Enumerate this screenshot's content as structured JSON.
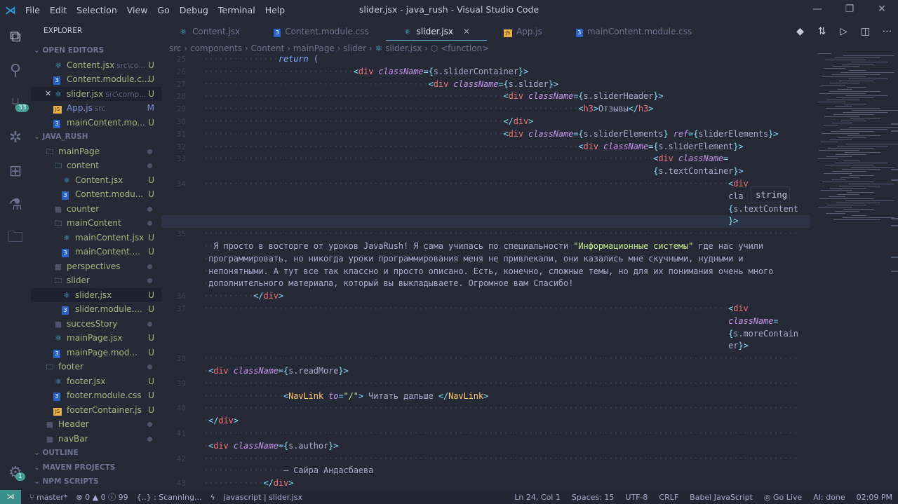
{
  "window": {
    "title": "slider.jsx - java_rush - Visual Studio Code",
    "menu": [
      "File",
      "Edit",
      "Selection",
      "View",
      "Go",
      "Debug",
      "Terminal",
      "Help"
    ]
  },
  "activity": {
    "icons": [
      "files-icon",
      "search-icon",
      "source-control-icon",
      "debug-icon",
      "extensions-icon",
      "test-flask-icon",
      "folder-icon"
    ],
    "scm_badge": "33",
    "settings_badge": "1"
  },
  "sidebar": {
    "title": "EXPLORER",
    "rows": [
      {
        "kind": "section",
        "label": "OPEN EDITORS"
      },
      {
        "icon": "react",
        "label": "Content.jsx",
        "sub": "src\\co...",
        "status": "U",
        "level": 2
      },
      {
        "icon": "css",
        "label": "Content.module.c...",
        "status": "U",
        "level": 2
      },
      {
        "icon": "react",
        "label": "slider.jsx",
        "sub": "src\\comp...",
        "status": "U",
        "level": 2,
        "close": true,
        "selected": true
      },
      {
        "icon": "js",
        "label": "App.js",
        "sub": "src",
        "status": "M",
        "level": 2
      },
      {
        "icon": "css",
        "label": "mainContent.mo...",
        "status": "U",
        "level": 2
      },
      {
        "kind": "section",
        "label": "JAVA_RUSH"
      },
      {
        "icon": "folder",
        "label": "mainPage",
        "level": 1,
        "dot": true
      },
      {
        "icon": "folder",
        "label": "content",
        "level": 2,
        "dot": true
      },
      {
        "icon": "react",
        "label": "Content.jsx",
        "status": "U",
        "level": 3
      },
      {
        "icon": "css",
        "label": "Content.modu...",
        "status": "U",
        "level": 3
      },
      {
        "icon": "folder-closed",
        "label": "counter",
        "level": 2,
        "dot": true
      },
      {
        "icon": "folder",
        "label": "mainContent",
        "level": 2,
        "dot": true
      },
      {
        "icon": "react",
        "label": "mainContent.jsx",
        "status": "U",
        "level": 3
      },
      {
        "icon": "css",
        "label": "mainContent....",
        "status": "U",
        "level": 3
      },
      {
        "icon": "folder-closed",
        "label": "perspectives",
        "level": 2,
        "dot": true
      },
      {
        "icon": "folder",
        "label": "slider",
        "level": 2,
        "dot": true
      },
      {
        "icon": "react",
        "label": "slider.jsx",
        "status": "U",
        "level": 3,
        "selected": true
      },
      {
        "icon": "css",
        "label": "slider.module....",
        "status": "U",
        "level": 3
      },
      {
        "icon": "folder-closed",
        "label": "succesStory",
        "level": 2,
        "dot": true
      },
      {
        "icon": "react",
        "label": "mainPage.jsx",
        "status": "U",
        "level": 2
      },
      {
        "icon": "css",
        "label": "mainPage.mod...",
        "status": "U",
        "level": 2
      },
      {
        "icon": "folder",
        "label": "footer",
        "level": 1,
        "dot": true
      },
      {
        "icon": "react",
        "label": "footer.jsx",
        "status": "U",
        "level": 2
      },
      {
        "icon": "css",
        "label": "footer.module.css",
        "status": "U",
        "level": 2
      },
      {
        "icon": "js",
        "label": "footerContainer.js",
        "status": "U",
        "level": 2
      },
      {
        "icon": "folder-closed",
        "label": "Header",
        "level": 1,
        "dot": true
      },
      {
        "icon": "folder-closed",
        "label": "navBar",
        "level": 1,
        "dot": true
      },
      {
        "kind": "section",
        "label": "OUTLINE"
      },
      {
        "kind": "section",
        "label": "MAVEN PROJECTS"
      },
      {
        "kind": "section",
        "label": "NPM SCRIPTS"
      }
    ]
  },
  "tabs": [
    {
      "icon": "react",
      "label": "Content.jsx"
    },
    {
      "icon": "css",
      "label": "Content.module.css"
    },
    {
      "icon": "react",
      "label": "slider.jsx",
      "active": true
    },
    {
      "icon": "js",
      "label": "App.js"
    },
    {
      "icon": "css",
      "label": "mainContent.module.css"
    }
  ],
  "breadcrumb": [
    "src",
    "components",
    "Content",
    "mainPage",
    "slider",
    "slider.jsx",
    "<function>"
  ],
  "editor": {
    "rows": [
      {
        "n": "25",
        "t": "               return ("
      },
      {
        "n": "26",
        "t": "                              <div className={s.sliderContainer}>"
      },
      {
        "n": "27",
        "t": "                                             <div className={s.slider}>"
      },
      {
        "n": "28",
        "t": "                                                            <div className={s.sliderHeader}>"
      },
      {
        "n": "29",
        "t": "                                                                           <h3>Отзывы</h3>"
      },
      {
        "n": "30",
        "t": "                                                            </div>"
      },
      {
        "n": "31",
        "t": "                                                            <div className={s.sliderElements} ref={sliderElements}>"
      },
      {
        "n": "32",
        "t": "                                                                           <div className={s.sliderElement}>"
      },
      {
        "n": "33",
        "t": "                                                                                          <div className="
      },
      {
        "n": "",
        "t": "                                                                                          {s.textContainer}>"
      },
      {
        "n": "34",
        "t": "                                                                                                         <div"
      },
      {
        "n": "",
        "t": "                                                                                                         cla"
      },
      {
        "n": "",
        "t": "                                                                                                         {s.textContent"
      },
      {
        "n": "",
        "t": "                                                                                                         }>",
        "cur": true
      },
      {
        "n": "35",
        "t": "                                                                                                                       "
      },
      {
        "n": "",
        "t": "  Я просто в восторге от уроков JavaRush! Я сама училась по специальности \"Информационные системы\" где нас учили"
      },
      {
        "n": "",
        "t": " программировать, но никогда уроки программирования меня не привлекали, они казались мне скучными, нудными и"
      },
      {
        "n": "",
        "t": " непонятными. А тут все так классно и просто описано. Есть, конечно, сложные темы, но для их понимания очень много"
      },
      {
        "n": "",
        "t": " дополнительного материала, который вы выкладываете. Огромное вам Спасибо!"
      },
      {
        "n": "36",
        "t": "          </div>"
      },
      {
        "n": "37",
        "t": "                                                                                                         <div"
      },
      {
        "n": "",
        "t": "                                                                                                         className="
      },
      {
        "n": "",
        "t": "                                                                                                         {s.moreContain"
      },
      {
        "n": "",
        "t": "                                                                                                         er}>"
      },
      {
        "n": "38",
        "t": "                                                                                                                       "
      },
      {
        "n": "",
        "t": " <div className={s.readMore}>"
      },
      {
        "n": "39",
        "t": "                                                                                                                       "
      },
      {
        "n": "",
        "t": "                <NavLink to=\"/\"> Читать дальше </NavLink>"
      },
      {
        "n": "40",
        "t": "                                                                                                                       "
      },
      {
        "n": "",
        "t": " </div>"
      },
      {
        "n": "41",
        "t": "                                                                                                                       "
      },
      {
        "n": "",
        "t": " <div className={s.author}>"
      },
      {
        "n": "42",
        "t": "                                                                                                                       "
      },
      {
        "n": "",
        "t": "                — Сайра Андасбаева"
      },
      {
        "n": "43",
        "t": "            </div>"
      }
    ],
    "hover_tooltip": "string"
  },
  "statusbar": {
    "branch": "master*",
    "errors": "0",
    "warnings": "0",
    "info": "99",
    "scanning": "{..} : Scanning...",
    "lang_path": "javascript | slider.jsx",
    "position": "Ln 24, Col 1",
    "spaces": "Spaces: 15",
    "encoding": "UTF-8",
    "eol": "CRLF",
    "language": "Babel JavaScript",
    "golive": "Go Live",
    "ai": "AI: done",
    "time": "02:09 PM"
  },
  "colors": {
    "background": "#262a37",
    "tag": "#f07178",
    "attribute": "#c792ea",
    "punctuation": "#89ddff",
    "component": "#ffcb6b",
    "untracked": "#a5b57e",
    "modified": "#7c8fd0"
  }
}
